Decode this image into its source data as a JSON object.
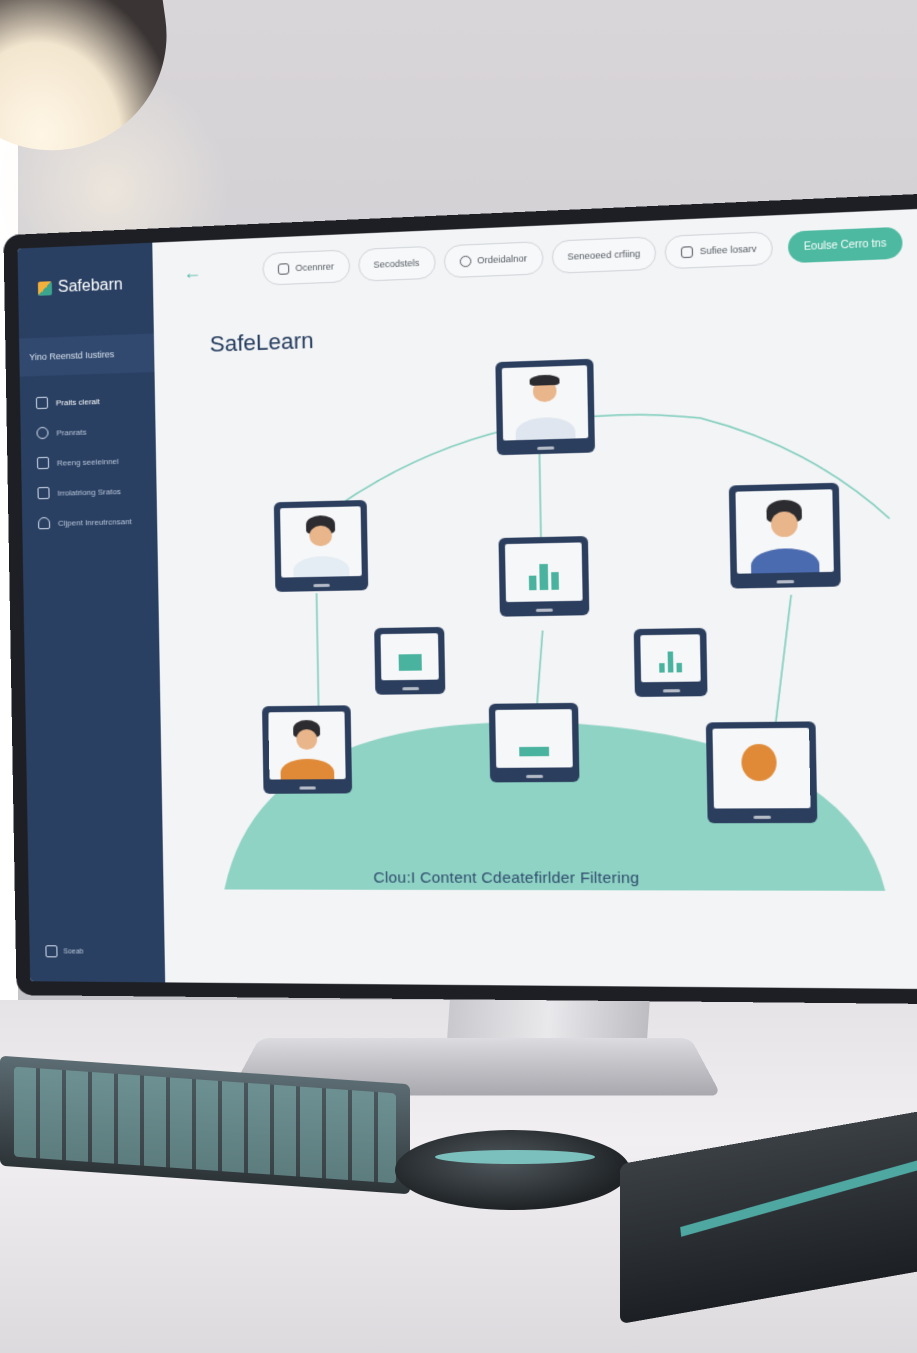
{
  "sidebar": {
    "brand": "Safebarn",
    "subtitle": "Yino Reenstd Iustires",
    "items": [
      {
        "label": "Praits clerait",
        "icon": "folder-icon"
      },
      {
        "label": "Pranrats",
        "icon": "pin-icon"
      },
      {
        "label": "Reeng seeleinnel",
        "icon": "home-icon"
      },
      {
        "label": "Irrolatriong Sratos",
        "icon": "book-icon"
      },
      {
        "label": "Cljpent Inreutrcnsant",
        "icon": "user-icon"
      }
    ],
    "footer_label": "Soeab"
  },
  "toolbar": {
    "back_glyph": "←",
    "pills": [
      {
        "label": "Ocennrer",
        "icon": "bell-icon"
      },
      {
        "label": "Secodstels",
        "icon": ""
      },
      {
        "label": "Ordeidalnor",
        "icon": "search-icon"
      },
      {
        "label": "Seneoeed crfiing",
        "icon": ""
      },
      {
        "label": "Sufiee losarv",
        "icon": "box-icon"
      }
    ],
    "cta_label": "Eoulse Cerro tns"
  },
  "page": {
    "title": "SafeLearn",
    "caption": "Clou:I Content Cdeatefirlder Filtering"
  },
  "colors": {
    "sidebar": "#2a4063",
    "accent": "#4cb9a0",
    "teal_area": "#7ccdbb"
  }
}
